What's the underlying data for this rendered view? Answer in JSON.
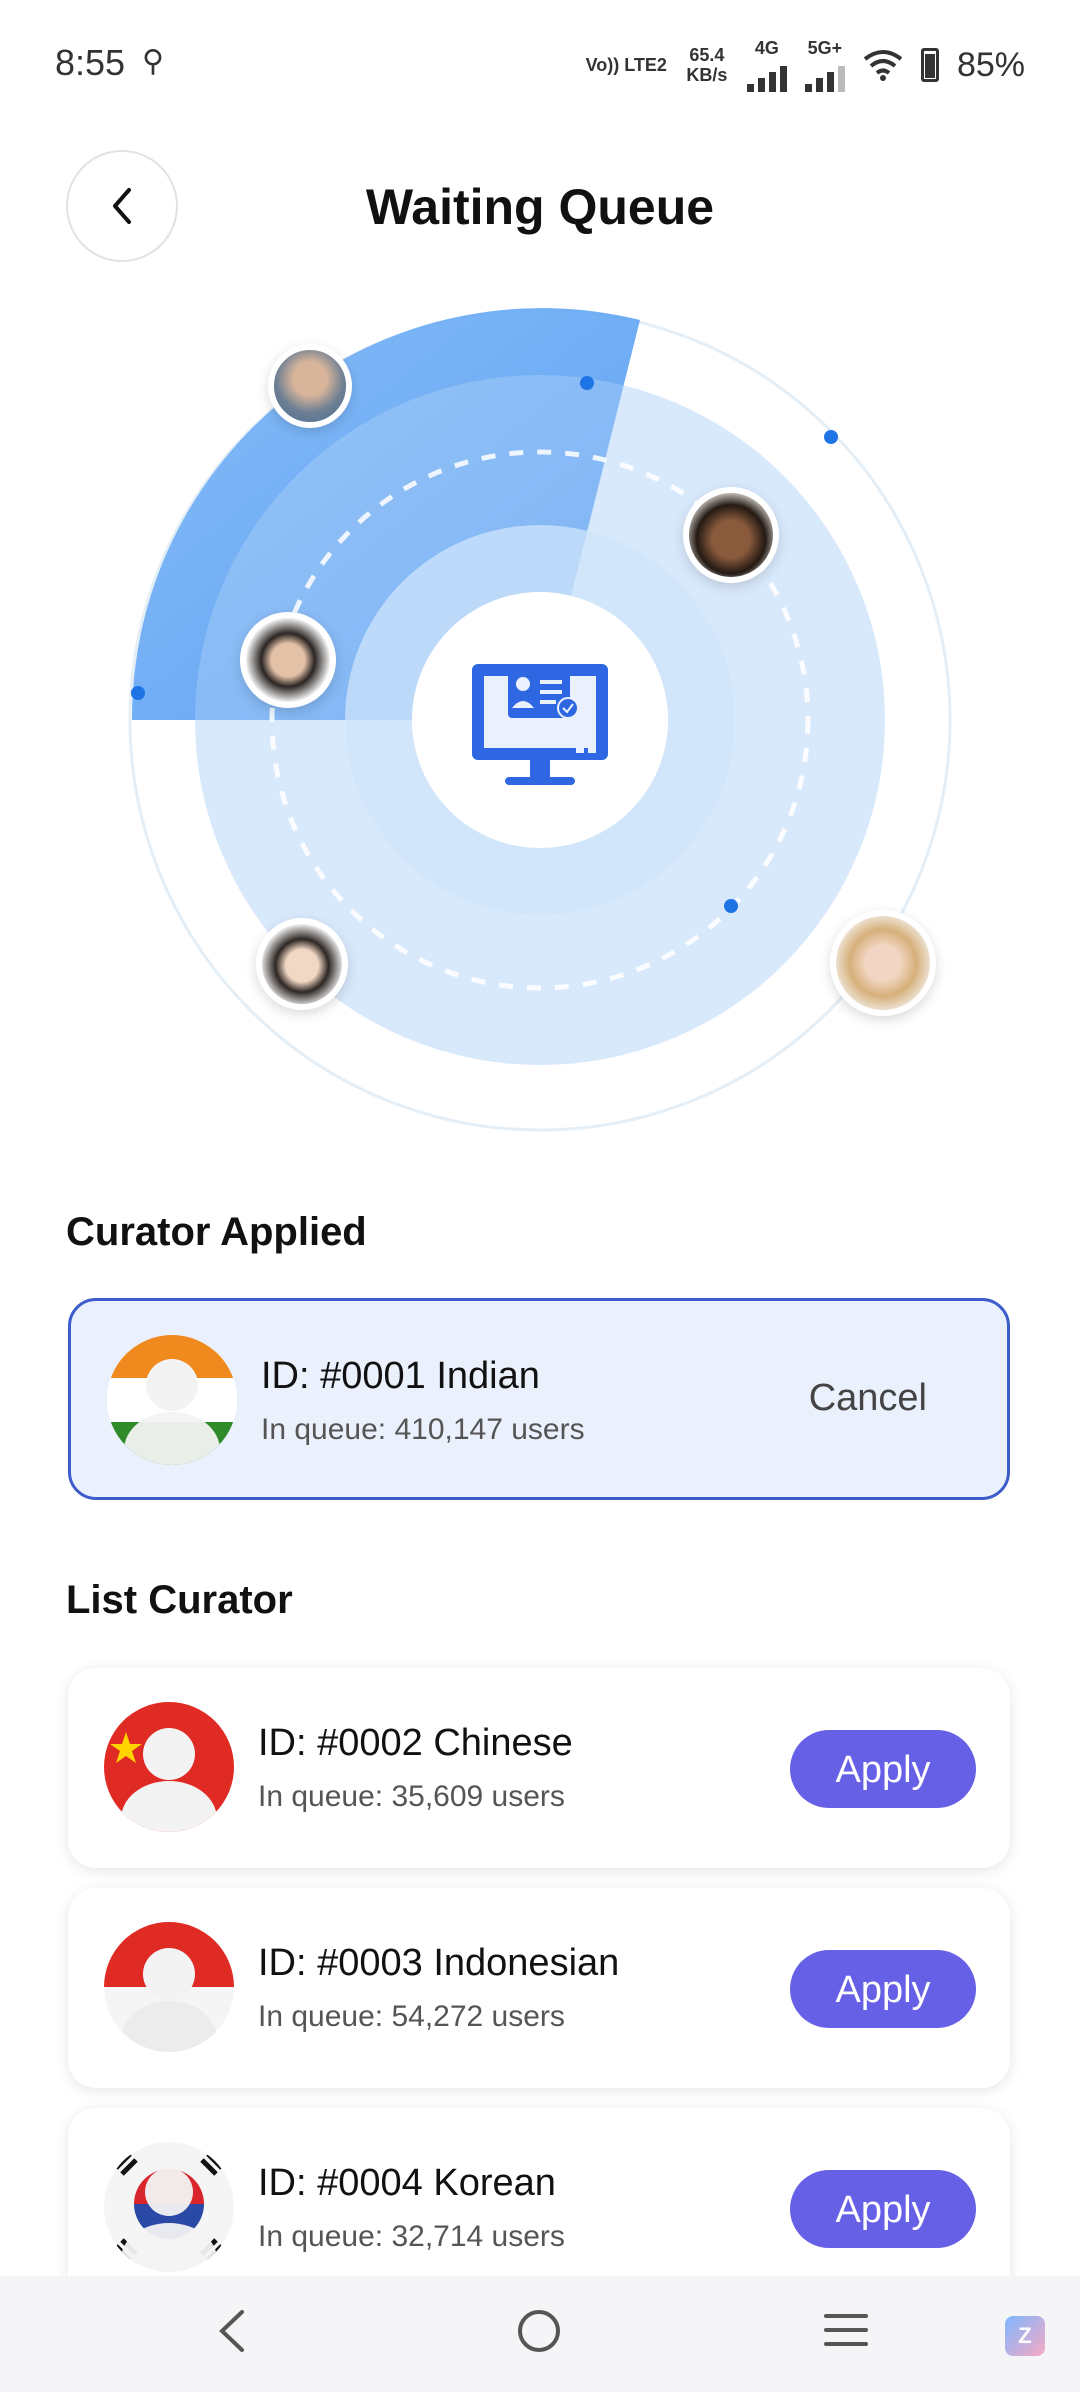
{
  "status_bar": {
    "time": "8:55",
    "volte": "Vo)) LTE2",
    "speed": "65.4 KB/s",
    "net1": "4G",
    "net2": "5G+",
    "battery": "85%"
  },
  "header": {
    "title": "Waiting Queue"
  },
  "applied_section": {
    "title": "Curator Applied",
    "card": {
      "id": "ID: #0001 Indian",
      "queue": "In queue: 410,147 users",
      "action": "Cancel"
    }
  },
  "list_section": {
    "title": "List Curator",
    "items": [
      {
        "id": "ID: #0002 Chinese",
        "queue": "In queue: 35,609 users",
        "action": "Apply",
        "flag": "china"
      },
      {
        "id": "ID: #0003 Indonesian",
        "queue": "In queue: 54,272 users",
        "action": "Apply",
        "flag": "indonesia"
      },
      {
        "id": "ID: #0004 Korean",
        "queue": "In queue: 32,714 users",
        "action": "Apply",
        "flag": "korea"
      }
    ]
  },
  "colors": {
    "accent": "#6660e6",
    "applied_border": "#3b5cc9",
    "applied_bg": "#eaf1fd",
    "radar_blue": "#5aa2f3"
  },
  "icons": [
    "back-icon",
    "curator-monitor-icon",
    "nav-back-icon",
    "nav-home-icon",
    "nav-menu-icon"
  ]
}
